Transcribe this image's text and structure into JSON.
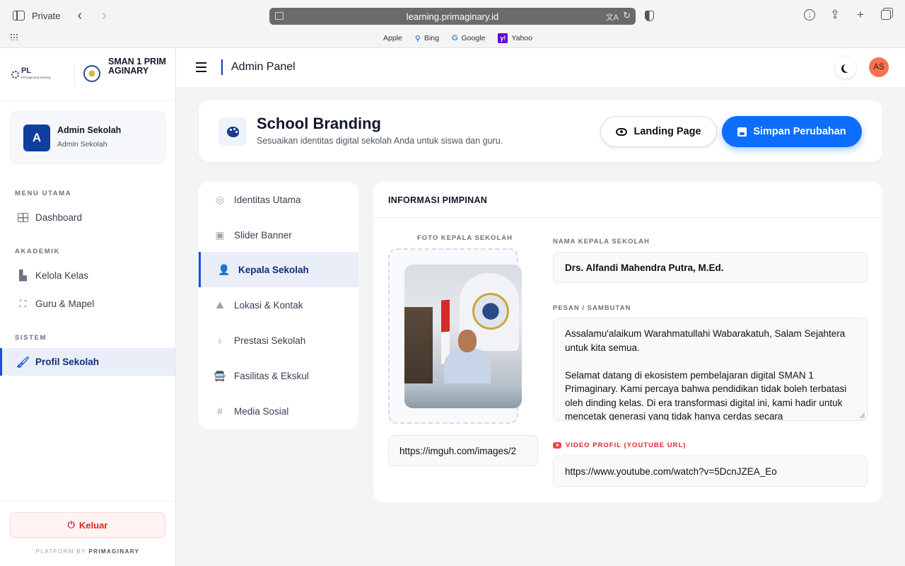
{
  "browser": {
    "private_label": "Private",
    "url": "learning.primaginary.id",
    "bookmarks": [
      "Apple",
      "Bing",
      "Google",
      "Yahoo"
    ]
  },
  "sidebar": {
    "pl_brand": "PL",
    "pl_sub": "PrimaginaryLearning",
    "school_name": "SMAN 1 PRIMAGINARY",
    "user": {
      "initial": "A",
      "name": "Admin Sekolah",
      "role": "Admin Sekolah"
    },
    "sections": {
      "main": "MENU UTAMA",
      "academic": "AKADEMIK",
      "system": "SISTEM"
    },
    "items": {
      "dashboard": "Dashboard",
      "kelas": "Kelola Kelas",
      "guru": "Guru & Mapel",
      "profil": "Profil Sekolah"
    },
    "logout": "Keluar",
    "platform_prefix": "PLATFORM BY ",
    "platform_name": "PRIMAGINARY"
  },
  "topbar": {
    "title": "Admin Panel",
    "avatar": "AS"
  },
  "header": {
    "title": "School Branding",
    "subtitle": "Sesuaikan identitas digital sekolah Anda untuk siswa dan guru.",
    "landing_label": "Landing Page",
    "save_label": "Simpan Perubahan"
  },
  "subnav": {
    "items": [
      "Identitas Utama",
      "Slider Banner",
      "Kepala Sekolah",
      "Lokasi & Kontak",
      "Prestasi Sekolah",
      "Fasilitas & Ekskul",
      "Media Sosial"
    ],
    "active": "Kepala Sekolah"
  },
  "panel": {
    "title": "INFORMASI PIMPINAN",
    "photo_label": "FOTO KEPALA SEKOLAH",
    "photo_url": "https://imguh.com/images/2",
    "name_label": "NAMA KEPALA SEKOLAH",
    "name_value": "Drs. Alfandi Mahendra Putra, M.Ed.",
    "message_label": "PESAN / SAMBUTAN",
    "message_value": "Assalamu'alaikum Warahmatullahi Wabarakatuh, Salam Sejahtera untuk kita semua.\n\nSelamat datang di ekosistem pembelajaran digital SMAN 1 Primaginary. Kami percaya bahwa pendidikan tidak boleh terbatasi oleh dinding kelas. Di era transformasi digital ini, kami hadir untuk mencetak generasi yang tidak hanya cerdas secara",
    "video_label": "VIDEO PROFIL (YOUTUBE URL)",
    "video_value": "https://www.youtube.com/watch?v=5DcnJZEA_Eo"
  },
  "colors": {
    "accent": "#0d6efd",
    "brand_navy": "#0f3f9e",
    "danger": "#dc2626"
  }
}
